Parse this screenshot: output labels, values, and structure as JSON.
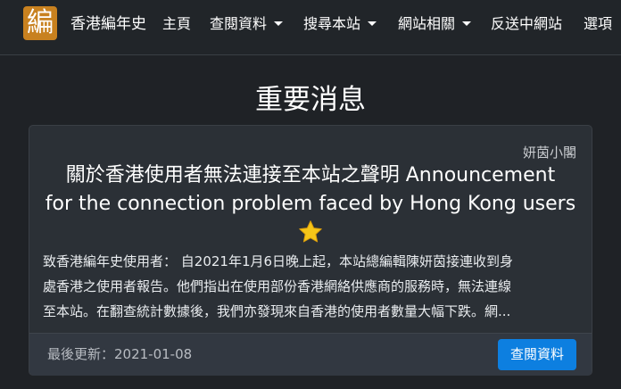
{
  "navbar": {
    "logo_text": "編",
    "brand": "香港編年史",
    "items": [
      {
        "label": "主頁"
      },
      {
        "label": "查閱資料"
      },
      {
        "label": "搜尋本站"
      },
      {
        "label": "網站相關"
      },
      {
        "label": "反送中網站"
      },
      {
        "label": "選項"
      }
    ]
  },
  "page_title": "重要消息",
  "announcement": {
    "author": "妍茵小閣",
    "title_line1": "關於香港使用者無法連接至本站之聲明 Announcement",
    "title_line2": "for the connection problem faced by Hong Kong users",
    "star_icon": "star-icon",
    "excerpt_lines": [
      "致香港編年史使用者： 自2021年1月6日晚上起，本站總編輯陳妍茵接連收到身",
      "處香港之使用者報告。他們指出在使用部份香港網絡供應商的服務時，無法連線",
      "至本站。在翻查統計數據後，我們亦發現來自香港的使用者數量大幅下跌。網..."
    ],
    "updated": "最後更新：2021-01-08",
    "button_label": "查閱資料"
  },
  "colors": {
    "background": "#1f2226",
    "navbar": "#212529",
    "logo": "#c8811f",
    "card": "#2b3036",
    "button": "#0d7fe0",
    "star": "#f5c518"
  }
}
